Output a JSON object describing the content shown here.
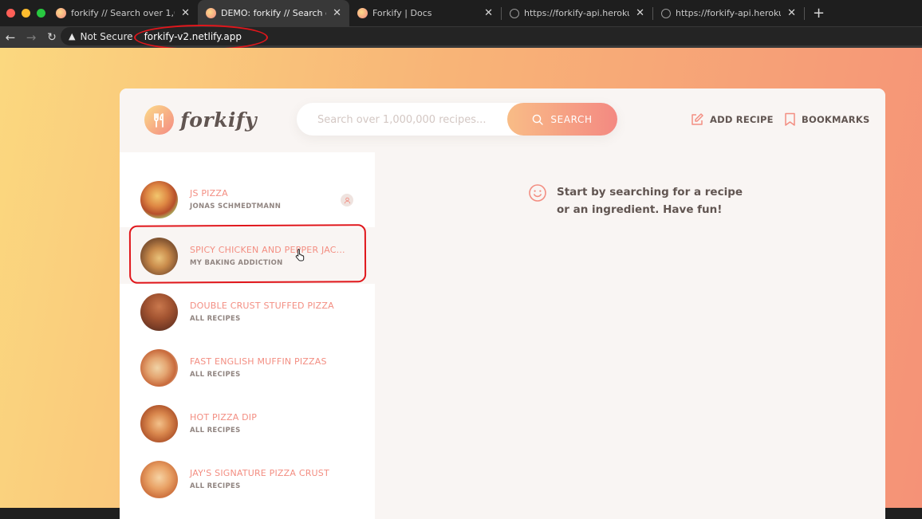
{
  "browser": {
    "tabs": [
      {
        "label": "forkify // Search over 1,000,00",
        "active": false,
        "icon": "forkify-favicon"
      },
      {
        "label": "DEMO: forkify // Search over 1,0",
        "active": true,
        "icon": "forkify-favicon"
      },
      {
        "label": "Forkify | Docs",
        "active": false,
        "icon": "forkify-favicon"
      },
      {
        "label": "https://forkify-api.herokuapp.co",
        "active": false,
        "icon": "globe-icon"
      },
      {
        "label": "https://forkify-api.herokuapp.co",
        "active": false,
        "icon": "globe-icon"
      }
    ],
    "security_label": "Not Secure",
    "url": "forkify-v2.netlify.app"
  },
  "header": {
    "logo_text": "forkify",
    "search_placeholder": "Search over 1,000,000 recipes...",
    "search_button": "SEARCH",
    "add_recipe": "ADD RECIPE",
    "bookmarks": "BOOKMARKS"
  },
  "results": [
    {
      "title": "JS PIZZA",
      "publisher": "JONAS SCHMEDTMANN",
      "user_generated": true
    },
    {
      "title": "SPICY CHICKEN AND PEPPER JAC...",
      "publisher": "MY BAKING ADDICTION",
      "hovered": true
    },
    {
      "title": "DOUBLE CRUST STUFFED PIZZA",
      "publisher": "ALL RECIPES"
    },
    {
      "title": "FAST ENGLISH MUFFIN PIZZAS",
      "publisher": "ALL RECIPES"
    },
    {
      "title": "HOT PIZZA DIP",
      "publisher": "ALL RECIPES"
    },
    {
      "title": "JAY'S SIGNATURE PIZZA CRUST",
      "publisher": "ALL RECIPES"
    }
  ],
  "message": {
    "text": "Start by searching for a recipe or an ingredient. Have fun!",
    "icon": "smile-icon"
  },
  "colors": {
    "brand_gradient_start": "#fbdb89",
    "brand_gradient_end": "#f48982",
    "title_text": "#f38e82",
    "body_text": "#615551",
    "annotation_red": "#e0161b"
  }
}
